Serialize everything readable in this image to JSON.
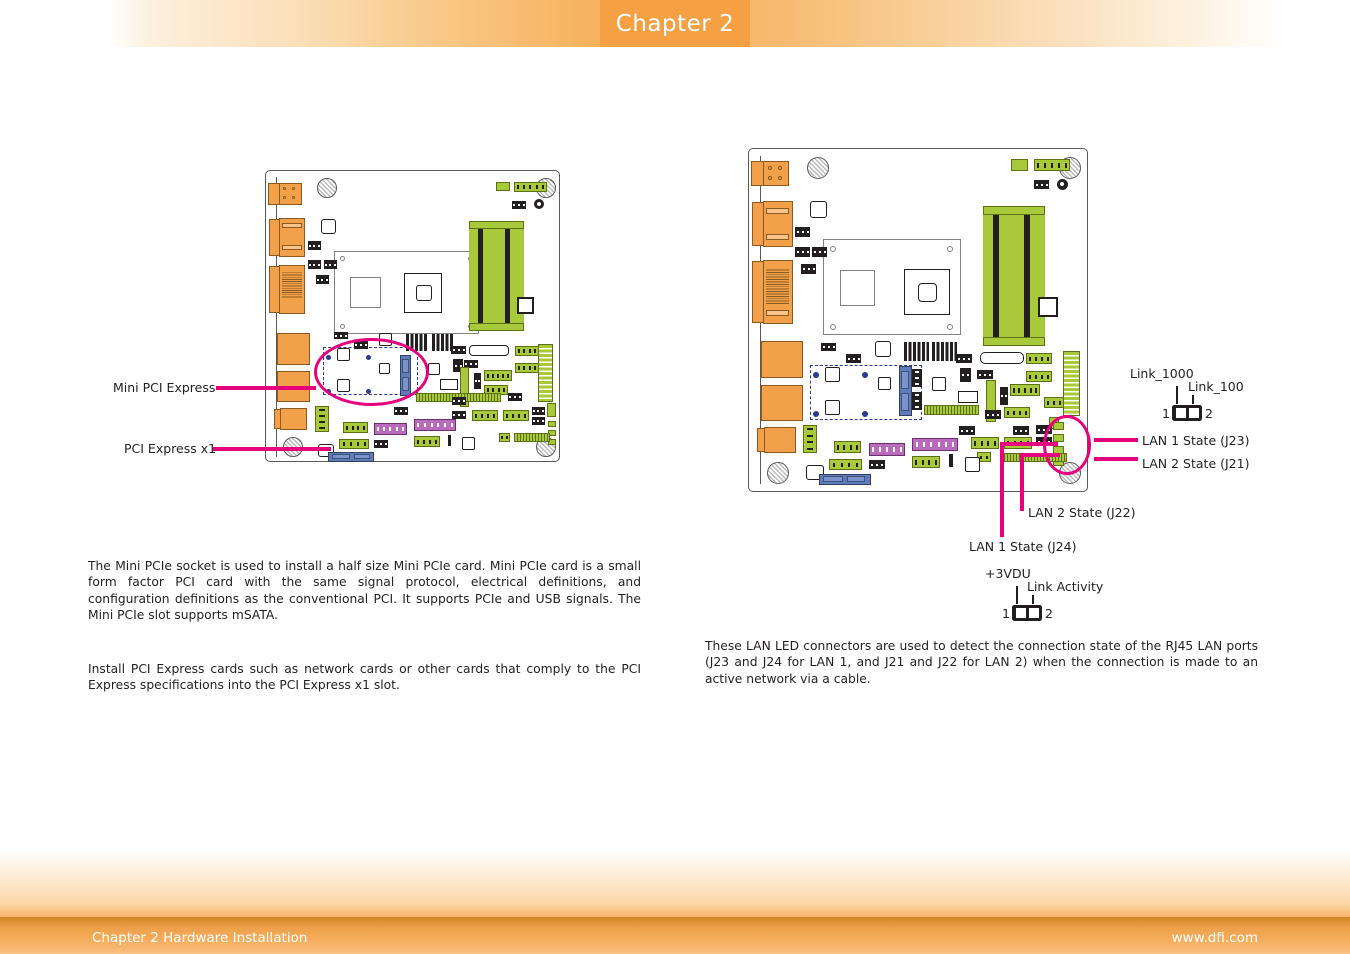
{
  "header": {
    "chapter_label": "Chapter 2"
  },
  "footer": {
    "left": "Chapter 2 Hardware Installation",
    "right": "www.dfi.com"
  },
  "colors": {
    "accent_orange": "#f4a043",
    "callout_magenta": "#e6007e",
    "pcb_green": "#a8c93a",
    "connector_orange": "#f3a04a",
    "connector_blue": "#7b93c9",
    "connector_purple": "#bb6bbb",
    "outline_gray": "#58595b",
    "text": "#231f20"
  },
  "left_figure": {
    "name": "mini-pcie-board-diagram",
    "callouts": [
      {
        "id": "mini-pci-express",
        "label": "Mini PCI Express"
      },
      {
        "id": "pci-express-x1",
        "label": "PCI Express x1"
      }
    ]
  },
  "right_figure": {
    "name": "lan-led-board-diagram",
    "callouts": [
      {
        "id": "lan1-state-j23",
        "label": "LAN 1 State (J23)"
      },
      {
        "id": "lan2-state-j21",
        "label": "LAN 2 State (J21)"
      },
      {
        "id": "lan2-state-j22",
        "label": "LAN 2 State (J22)"
      },
      {
        "id": "lan1-state-j24",
        "label": "LAN 1 State (J24)"
      }
    ]
  },
  "jumper_top": {
    "name": "link-speed-jumper",
    "pin1_signal": "Link_1000",
    "pin2_signal": "Link_100",
    "pin1_number": "1",
    "pin2_number": "2"
  },
  "jumper_bottom": {
    "name": "link-activity-jumper",
    "pin1_signal": "+3VDU",
    "pin2_signal": "Link Activity",
    "pin1_number": "1",
    "pin2_number": "2"
  },
  "paragraphs": {
    "mini_pcie": "The Mini PCIe socket is used to install a half size Mini PCIe card. Mini PCIe card is a small form factor PCI card with the same signal protocol, electrical definitions, and configuration definitions as the conventional PCI. It supports PCIe and USB signals. The Mini PCIe slot supports mSATA.",
    "pci_express": "Install PCI Express cards such as network cards or other cards that comply to the PCI Express specifications into the PCI Express x1 slot.",
    "lan_led": "These LAN LED connectors are used to detect the connection state of the RJ45 LAN ports (J23 and J24 for LAN 1, and J21 and J22 for LAN 2) when the connection is made to an active network via a cable."
  }
}
